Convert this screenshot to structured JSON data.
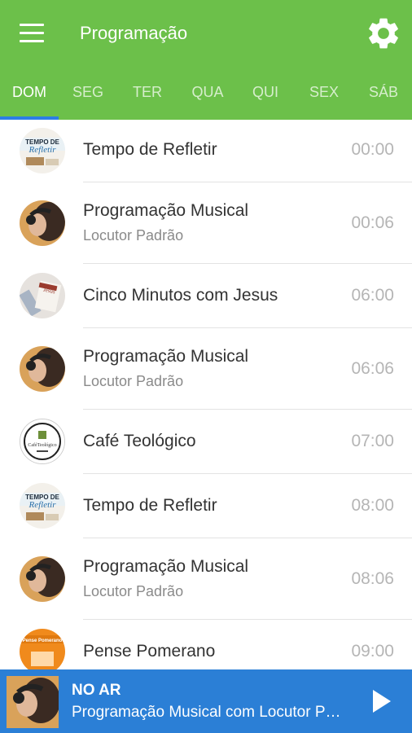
{
  "header": {
    "title": "Programação",
    "menu_icon": "hamburger-menu-icon",
    "settings_icon": "gear-icon"
  },
  "tabs": [
    {
      "label": "DOM",
      "active": true
    },
    {
      "label": "SEG",
      "active": false
    },
    {
      "label": "TER",
      "active": false
    },
    {
      "label": "QUA",
      "active": false
    },
    {
      "label": "QUI",
      "active": false
    },
    {
      "label": "SEX",
      "active": false
    },
    {
      "label": "SÁB",
      "active": false
    }
  ],
  "schedule": [
    {
      "title": "Tempo de Refletir",
      "subtitle": "",
      "time": "00:00",
      "thumb": "tempo-de-refletir-logo"
    },
    {
      "title": "Programação Musical",
      "subtitle": "Locutor Padrão",
      "time": "00:06",
      "thumb": "headphones-woman-photo"
    },
    {
      "title": "Cinco Minutos com Jesus",
      "subtitle": "",
      "time": "06:00",
      "thumb": "jesus-book-photo"
    },
    {
      "title": "Programação Musical",
      "subtitle": "Locutor Padrão",
      "time": "06:06",
      "thumb": "headphones-woman-photo"
    },
    {
      "title": "Café Teológico",
      "subtitle": "",
      "time": "07:00",
      "thumb": "cafe-teologico-logo"
    },
    {
      "title": "Tempo de Refletir",
      "subtitle": "",
      "time": "08:00",
      "thumb": "tempo-de-refletir-logo"
    },
    {
      "title": "Programação Musical",
      "subtitle": "Locutor Padrão",
      "time": "08:06",
      "thumb": "headphones-woman-photo"
    },
    {
      "title": "Pense Pomerano",
      "subtitle": "",
      "time": "09:00",
      "thumb": "pense-pomerano-logo"
    }
  ],
  "player": {
    "label": "NO AR",
    "title": "Programação Musical com Locutor Padrão",
    "play_icon": "play-icon"
  },
  "colors": {
    "header_green": "#6cc04a",
    "player_blue": "#2b7fd6",
    "tab_indicator": "#2c7ee5"
  }
}
